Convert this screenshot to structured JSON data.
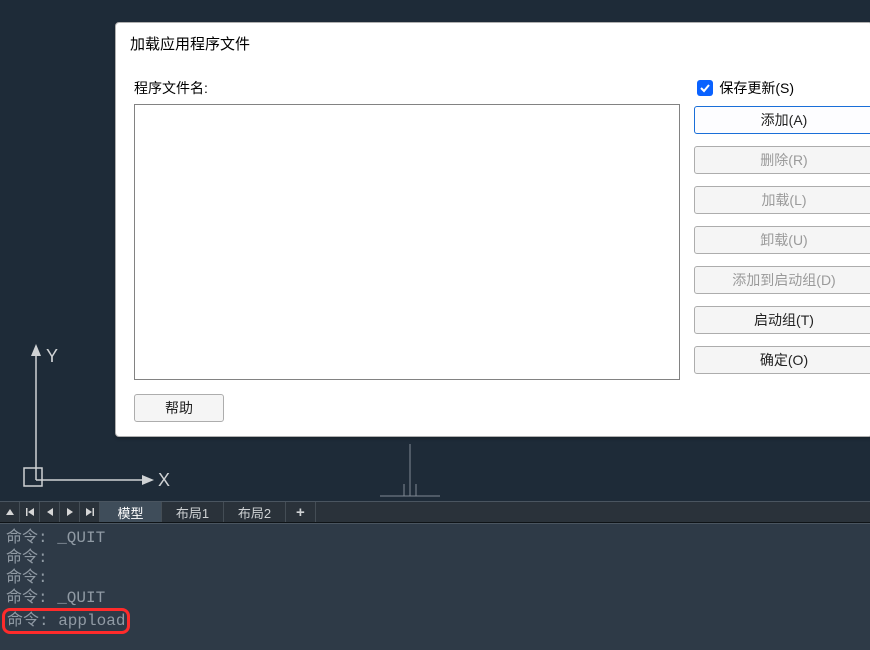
{
  "dialog": {
    "title": "加载应用程序文件",
    "filename_label": "程序文件名:",
    "save_update_label": "保存更新(S)",
    "save_update_checked": true,
    "buttons": {
      "add": "添加(A)",
      "delete": "删除(R)",
      "load": "加载(L)",
      "unload": "卸载(U)",
      "add_to_startup": "添加到启动组(D)",
      "startup_group": "启动组(T)",
      "ok": "确定(O)",
      "help": "帮助"
    }
  },
  "axis": {
    "x": "X",
    "y": "Y"
  },
  "tabs": {
    "items": [
      {
        "label": "模型",
        "active": true
      },
      {
        "label": "布局1",
        "active": false
      },
      {
        "label": "布局2",
        "active": false
      }
    ],
    "add": "+"
  },
  "command": {
    "lines": [
      "命令: _QUIT",
      "命令:",
      "命令:",
      "命令: _QUIT"
    ],
    "current": "命令: appload"
  }
}
